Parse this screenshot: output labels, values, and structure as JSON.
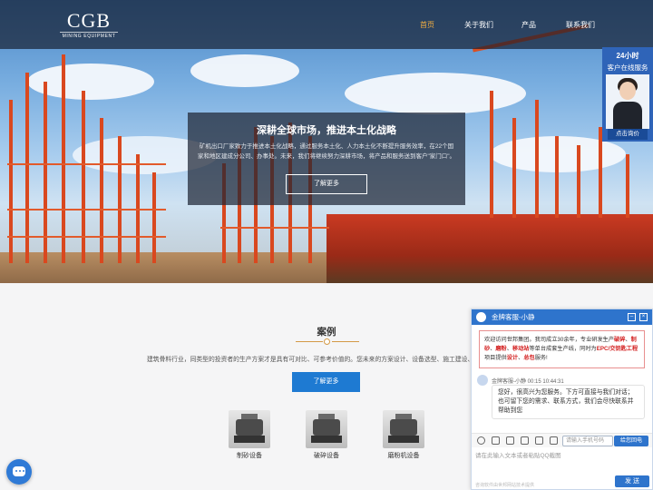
{
  "nav": {
    "logo_main": "CGB",
    "logo_sub": "MINING EQUIPMENT",
    "items": [
      "首页",
      "关于我们",
      "产品",
      "联系我们"
    ],
    "active_index": 0
  },
  "hero": {
    "title": "深耕全球市场，推进本土化战略",
    "text": "矿机出口厂家致力于推进本土化战略，通过服务本土化、人力本土化不断提升服务效率，在22个国家和地区建成分公司、办事处。未来，我们将继续努力深耕市场，将产品和服务送到客户\"家门口\"。",
    "button": "了解更多"
  },
  "service_widget": {
    "line1": "24小时",
    "line2": "客户在线服务",
    "button": "点击询价"
  },
  "cases": {
    "title": "案例",
    "description": "建筑骨料行业，同类型的投资者的生产方案才是具有可对比、可参考价值的。您未来的方案设计、设备选型、施工建设、运营",
    "button": "了解更多",
    "products": [
      {
        "label": "制砂设备",
        "icon": "sand-machine-icon"
      },
      {
        "label": "破碎设备",
        "icon": "crusher-icon"
      },
      {
        "label": "磨粉机设备",
        "icon": "mill-icon"
      }
    ]
  },
  "chat": {
    "header": "金牌客服-小静",
    "intro_parts": [
      {
        "t": "欢迎访问世邦集团。我司成立30余年，专业研发生产",
        "hl": false
      },
      {
        "t": "破碎",
        "hl": true
      },
      {
        "t": "、",
        "hl": false
      },
      {
        "t": "制砂",
        "hl": true
      },
      {
        "t": "、",
        "hl": false
      },
      {
        "t": "磨粉",
        "hl": true
      },
      {
        "t": "、",
        "hl": false
      },
      {
        "t": "移动站",
        "hl": true
      },
      {
        "t": "等单台成套生产线，同时为",
        "hl": false
      },
      {
        "t": "EPC/交钥匙工程",
        "hl": true
      },
      {
        "t": "项目提供",
        "hl": false
      },
      {
        "t": "设计",
        "hl": true
      },
      {
        "t": "、",
        "hl": false
      },
      {
        "t": "总包",
        "hl": true
      },
      {
        "t": "服务!",
        "hl": false
      }
    ],
    "msg_sender": "金牌客服-小静",
    "msg_time": "00:15 10:44:31",
    "msg_text": "您好，很高兴为您服务。下方可直接与我们对话；也可留下您的需求、联系方式，我们会尽快联系并帮助到您",
    "phone_placeholder": "请输入手机号码",
    "phone_button": "给您回电",
    "input_placeholder": "请在此输入文本或者粘贴QQ截图",
    "footer_text": "咨询软件由世邦网站技术提供",
    "send": "发 送"
  },
  "colors": {
    "nav_active": "#f5b041",
    "accent_blue": "#1e7ad2",
    "chat_blue": "#2e74cc",
    "highlight_red": "#d32121"
  }
}
